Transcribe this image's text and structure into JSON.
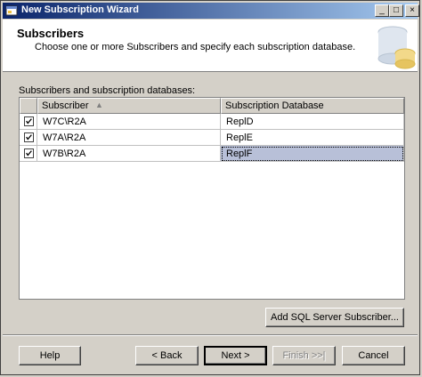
{
  "window": {
    "title": "New Subscription Wizard",
    "controls": {
      "minimize": "_",
      "maximize": "□",
      "close": "×"
    }
  },
  "header": {
    "title": "Subscribers",
    "subtitle": "Choose one or more Subscribers and specify each subscription database."
  },
  "grid": {
    "label": "Subscribers and subscription databases:",
    "columns": [
      "Subscriber",
      "Subscription Database"
    ],
    "sort_indicator": "▲",
    "rows": [
      {
        "checked": true,
        "subscriber": "W7C\\R2A",
        "database": "ReplD"
      },
      {
        "checked": true,
        "subscriber": "W7A\\R2A",
        "database": "ReplE"
      },
      {
        "checked": true,
        "subscriber": "W7B\\R2A",
        "database": "ReplF"
      }
    ]
  },
  "buttons": {
    "add_subscriber": "Add SQL Server Subscriber...",
    "help": "Help",
    "back": "< Back",
    "next": "Next >",
    "finish": "Finish >>|",
    "cancel": "Cancel"
  }
}
